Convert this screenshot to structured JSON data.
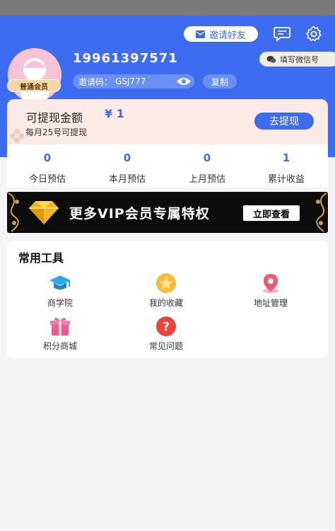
{
  "header": {
    "invite_friends": "邀请好友",
    "phone": "19961397571",
    "fill_wechat": "填写微信号",
    "invite_code_label": "邀请码：",
    "invite_code": "GSJ777",
    "copy": "复制",
    "member_level": "普通会员",
    "brand_color": "#3d6cf0"
  },
  "withdraw": {
    "title": "可提现金额",
    "amount": "¥ 1",
    "note": "每月25号可提现",
    "button": "去提现"
  },
  "stats": [
    {
      "value": "0",
      "label": "今日预估"
    },
    {
      "value": "0",
      "label": "本月预估"
    },
    {
      "value": "0",
      "label": "上月预估"
    },
    {
      "value": "1",
      "label": "累计收益"
    }
  ],
  "vip_banner": {
    "text": "更多VIP会员专属特权",
    "button": "立即查看"
  },
  "tools": {
    "title": "常用工具",
    "items": [
      {
        "label": "商学院",
        "icon": "graduation-cap-icon"
      },
      {
        "label": "我的收藏",
        "icon": "star-icon"
      },
      {
        "label": "地址管理",
        "icon": "location-pin-icon"
      },
      {
        "label": "积分商城",
        "icon": "gift-icon"
      },
      {
        "label": "常见问题",
        "icon": "question-icon"
      }
    ]
  }
}
